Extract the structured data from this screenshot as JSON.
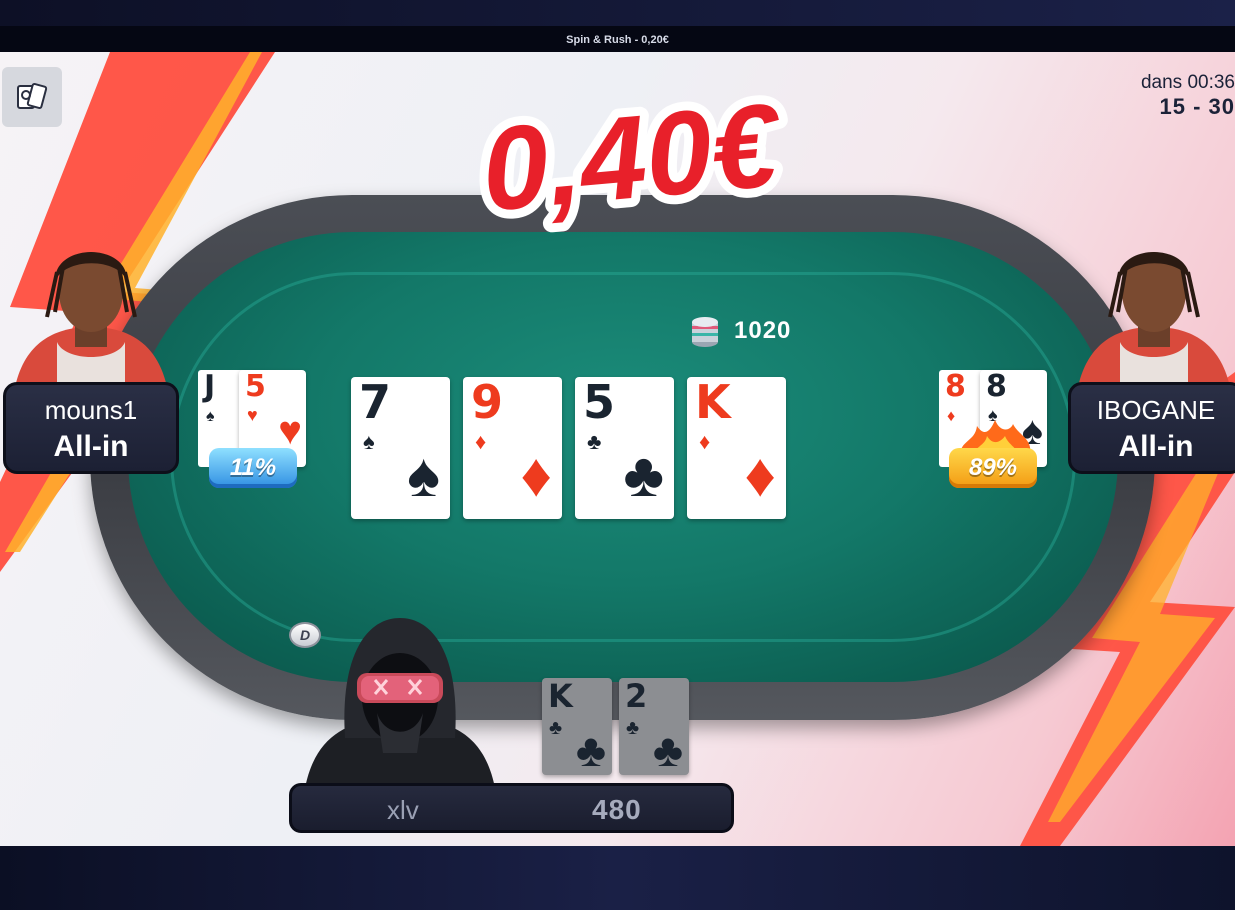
{
  "window": {
    "title": "Spin & Rush - 0,20€"
  },
  "prize": {
    "amount": "0,40€"
  },
  "blinds": {
    "timer": "dans 00:36",
    "level": "15 - 30"
  },
  "pot": {
    "amount": "1020"
  },
  "board": [
    {
      "rank": "7",
      "suit": "♠",
      "color": "black"
    },
    {
      "rank": "9",
      "suit": "♦",
      "color": "red"
    },
    {
      "rank": "5",
      "suit": "♣",
      "color": "black"
    },
    {
      "rank": "K",
      "suit": "♦",
      "color": "red"
    }
  ],
  "players": {
    "left": {
      "name": "mouns1",
      "status": "All-in",
      "equity": "11%",
      "cards": [
        {
          "rank": "J",
          "suit": "♠",
          "color": "black"
        },
        {
          "rank": "5",
          "suit": "♥",
          "color": "red"
        }
      ]
    },
    "right": {
      "name": "IBOGANE",
      "status": "All-in",
      "equity": "89%",
      "cards": [
        {
          "rank": "8",
          "suit": "♦",
          "color": "red"
        },
        {
          "rank": "8",
          "suit": "♠",
          "color": "black"
        }
      ]
    },
    "hero": {
      "name": "xlv",
      "stack": "480",
      "cards": [
        {
          "rank": "K",
          "suit": "♣",
          "color": "black"
        },
        {
          "rank": "2",
          "suit": "♣",
          "color": "black"
        }
      ]
    }
  },
  "dealer_button": {
    "label": "D"
  },
  "colors": {
    "felt": "#137868",
    "rail": "#45484e",
    "prize_red": "#e8202a",
    "card_red": "#ee3b1e",
    "equity_low": "#2f8ee2",
    "equity_high": "#f39a12"
  },
  "icons": {
    "history": "hand-history-icon",
    "pot_chips": "chip-stack-icon"
  }
}
